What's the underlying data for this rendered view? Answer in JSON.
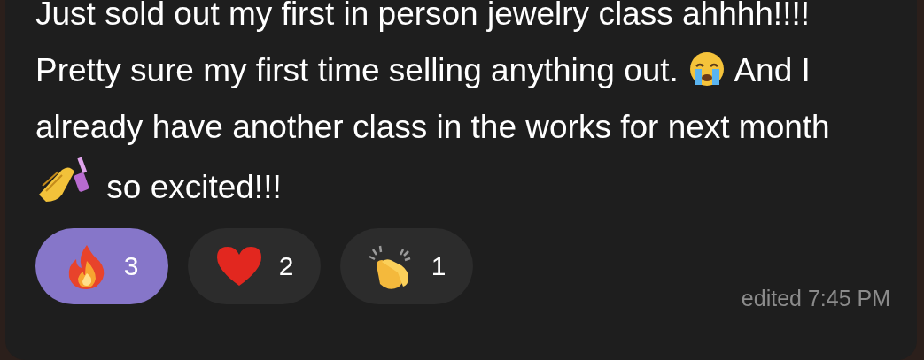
{
  "message": {
    "segments": [
      {
        "kind": "text",
        "text": "Just sold out my first in person jewelry class ahhhh!!!! Pretty sure my first time selling anything out. "
      },
      {
        "kind": "crying-face"
      },
      {
        "kind": "text",
        "text": " And I already have another class in the works for next month "
      },
      {
        "kind": "nail-polish"
      },
      {
        "kind": "text",
        "text": " so excited!!!"
      }
    ]
  },
  "reactions": [
    {
      "kind": "fire",
      "count": "3",
      "selected": true
    },
    {
      "kind": "heart",
      "count": "2",
      "selected": false
    },
    {
      "kind": "clap",
      "count": "1",
      "selected": false
    }
  ],
  "status": "edited 7:45 PM"
}
